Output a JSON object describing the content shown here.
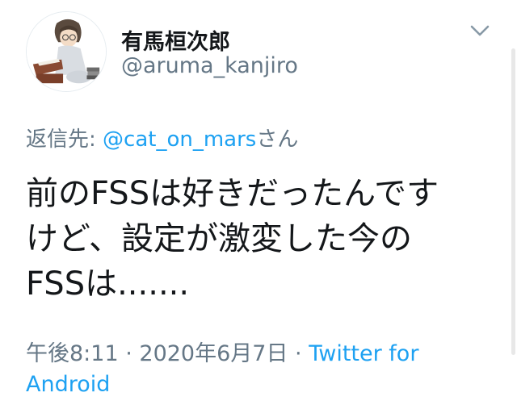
{
  "user": {
    "display_name": "有馬桓次郎",
    "handle": "@aruma_kanjiro",
    "avatar_icon": "avatar-illustration"
  },
  "header": {
    "menu_icon": "chevron-down-icon"
  },
  "reply": {
    "prefix": "返信先: ",
    "mention": "@cat_on_mars",
    "suffix": "さん"
  },
  "tweet": {
    "lines": [
      "前のFSSは好きだったんです",
      "けど、設定が激変した今の",
      "FSSは......."
    ]
  },
  "meta": {
    "time": "午後8:11",
    "separator": " · ",
    "date": "2020年6月7日",
    "source": "Twitter for Android"
  },
  "colors": {
    "text": "#14171a",
    "secondary": "#657786",
    "link": "#1da1f2"
  }
}
